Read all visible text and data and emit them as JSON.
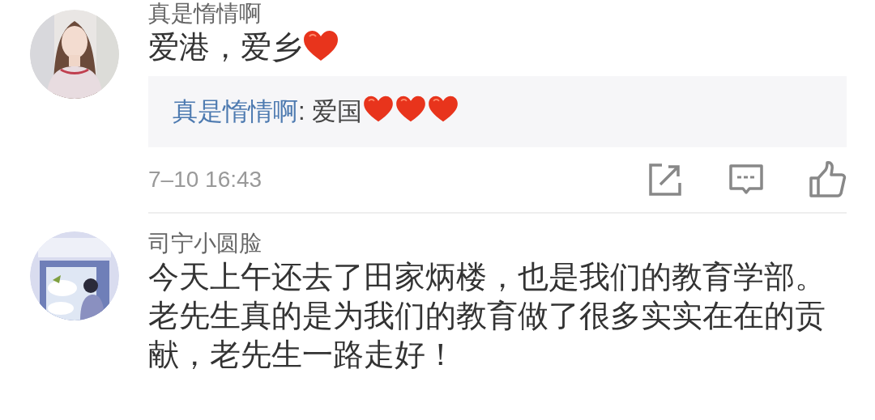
{
  "comments": [
    {
      "avatar": {
        "kind": "picture"
      },
      "username": "真是惰情啊",
      "content": [
        {
          "kind": "text",
          "text": "爱港，爱乡"
        },
        {
          "kind": "emoji"
        }
      ],
      "reply": {
        "username": "真是惰情啊",
        "separator": ":",
        "content": [
          {
            "kind": "text",
            "text": " 爱国"
          },
          {
            "kind": "emoji"
          },
          {
            "kind": "emoji"
          },
          {
            "kind": "emoji"
          }
        ]
      },
      "time": "7–10 16:43",
      "actions": [
        {
          "kind": "share"
        },
        {
          "kind": "comment"
        },
        {
          "kind": "like"
        }
      ]
    },
    {
      "avatar": {
        "kind": "picture"
      },
      "username": "司宁小圆脸",
      "content": [
        {
          "kind": "text",
          "text": "今天上午还去了田家炳楼，也是我们的教育学部。老先生真的是为我们的教育做了很多实实在在的贡献，老先生一路走好！"
        }
      ]
    }
  ]
}
